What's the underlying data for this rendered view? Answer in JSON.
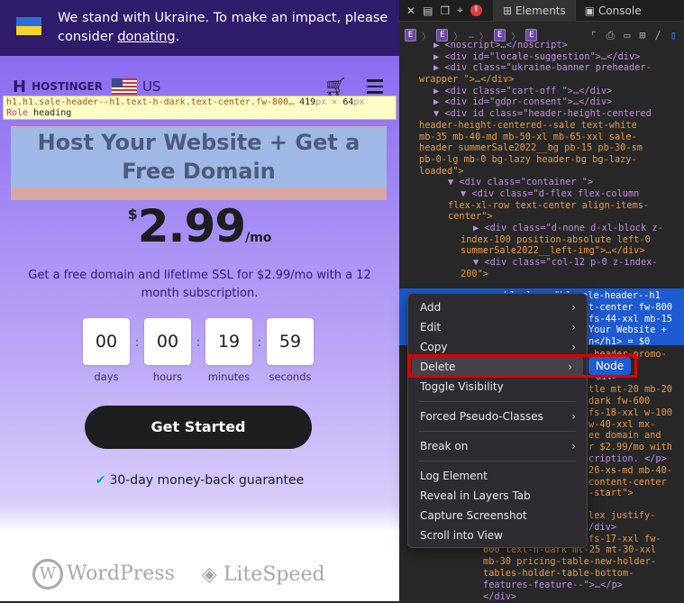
{
  "page": {
    "banner": {
      "text": "We stand with Ukraine. To make an impact, please consider ",
      "link": "donating",
      "end": "."
    },
    "nav": {
      "brand": "HOSTINGER",
      "region": "US"
    },
    "inspector_tooltip": {
      "selector": "h1.h1.sale-header--h1.text-h-dark.text-center.fw-800…",
      "width": "419",
      "height": "64",
      "unit": "px",
      "times": "×",
      "role_label": "Role",
      "role": "heading"
    },
    "headline": "Host Your Website + Get a Free Domain",
    "price": {
      "currency": "$",
      "amount": "2.99",
      "period": "/mo"
    },
    "description": "Get a free domain and lifetime SSL for $2.99/mo with a 12 month subscription.",
    "countdown": [
      {
        "value": "00",
        "label": "days"
      },
      {
        "value": "00",
        "label": "hours"
      },
      {
        "value": "19",
        "label": "minutes"
      },
      {
        "value": "59",
        "label": "seconds"
      }
    ],
    "cta": "Get Started",
    "guarantee": "30-day money-back guarantee",
    "logos": [
      "WordPress",
      "LiteSpeed"
    ]
  },
  "devtools": {
    "tabs": [
      "Elements",
      "Console"
    ],
    "active_tab": "Elements",
    "breadcrumb": [
      "E",
      "E",
      "…",
      "E",
      "E"
    ],
    "lines": [
      "▶ <noscript>…</noscript>",
      "▶ <div id=\"locale-suggestion\">…</div>",
      "▶ <div class=\"ukraine-banner preheader-",
      "wrapper \">…</div>",
      "▶ <div class=\"cart-off \">…</div>",
      "▶ <div id=\"gdpr-consent\">…</div>",
      "▼ <div id class=\"header-height-centered",
      "header-height-centered--sale text-white",
      "mb-35 mb-40-md mb-50-xl mb-65-xxl sale-",
      "header summerSale2022__bg pb-15 pb-30-sm",
      "pb-0-lg mb-0 bg-lazy header-bg bg-lazy-",
      "loaded\">",
      "▼ <div class=\"container \">",
      "▼ <div class=\"d-flex flex-column",
      "flex-xl-row text-center align-items-",
      "center\">",
      "▶ <div class=\"d-none d-xl-block z-",
      "index-100 position-absolute left-0",
      "summerSale2022__left-img\">…</div>",
      "▼ <div class=\"col-12 p-0 z-index-",
      "200\">"
    ],
    "selected_fragments": [
      "<h1 class=\"h1 sale-header--h1",
      "t-center fw-800",
      "fs-44-xxl mb-15",
      "Your Website +",
      "n</h1> = $0"
    ],
    "visible_fragments": [
      "-header-promo-",
      "ition-",
      "div>",
      "tle mt-20 mb-20",
      "dark fw-600",
      "fs-18-xxl w-100",
      "w-40-xxl mx-",
      "ee domain and",
      "r $2.99/mo with",
      "cription. </p>",
      "26-xs-md mb-40-",
      "content-center",
      "-start\">",
      "lex justify-",
      "/div>",
      "fs-17-xxl fw-",
      "600 text-h-dark mt-25 mt-30-xxl",
      "mb-30 pricing-table-new-holder-",
      "tables-holder-table-bottom-",
      "features-feature--\">…</p>",
      "</div>"
    ],
    "context_menu": {
      "items": [
        {
          "label": "Add",
          "submenu": true
        },
        {
          "label": "Edit",
          "submenu": true
        },
        {
          "label": "Copy",
          "submenu": true
        },
        {
          "label": "Delete",
          "submenu": true,
          "highlighted": true
        },
        {
          "label": "Toggle Visibility",
          "submenu": false
        },
        {
          "label": "Forced Pseudo-Classes",
          "submenu": true
        },
        {
          "label": "Break on",
          "submenu": true
        },
        {
          "label": "Log Element",
          "submenu": false
        },
        {
          "label": "Reveal in Layers Tab",
          "submenu": false
        },
        {
          "label": "Capture Screenshot",
          "submenu": false
        },
        {
          "label": "Scroll into View",
          "submenu": false
        }
      ],
      "submenu_item": "Node",
      "annotation_color": "#e00000"
    }
  },
  "colors": {
    "banner": "#2f1c6a",
    "hero": "#8a6cf0",
    "cta": "#1d1e20",
    "selection": "#1f5bd0"
  }
}
